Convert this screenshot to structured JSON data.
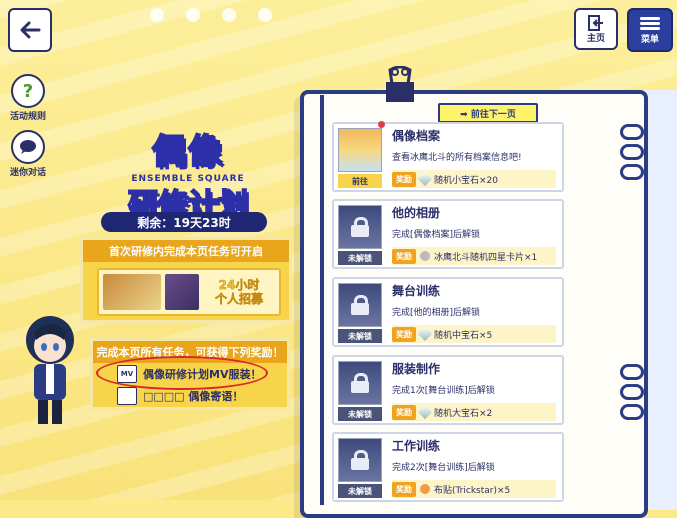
{
  "topbar": {
    "home_label": "主页",
    "menu_label": "菜单"
  },
  "side": {
    "rules_label": "活动规则",
    "chat_label": "迷你对话"
  },
  "event": {
    "title_line1": "偶像",
    "subtitle": "ENSEMBLE SQUARE",
    "title_line2": "研修计划",
    "remaining": "剩余：19天23时"
  },
  "first_box": {
    "title": "首次研修内完成本页任务可开启",
    "banner_text_line1": "24小时",
    "banner_text_line2": "个人招募"
  },
  "reward_box": {
    "title": "完成本页所有任务，可获得下列奖励！",
    "line1": "偶像研修计划MV服装！",
    "line1_icon": "MV",
    "line2": "□□□□ 偶像寄语！"
  },
  "notebook": {
    "next_page": "➡ 前往下一页",
    "reward_badge": "奖励",
    "cards": [
      {
        "title": "偶像档案",
        "desc": "查看冰鹰北斗的所有档案信息吧!",
        "status": "前往",
        "reward": "随机小宝石×20",
        "locked": false
      },
      {
        "title": "他的相册",
        "desc": "完成[偶像档案]后解锁",
        "status": "未解锁",
        "reward": "冰鹰北斗随机四星卡片×1",
        "locked": true
      },
      {
        "title": "舞台训练",
        "desc": "完成[他的相册]后解锁",
        "status": "未解锁",
        "reward": "随机中宝石×5",
        "locked": true
      },
      {
        "title": "服装制作",
        "desc": "完成1次[舞台训练]后解锁",
        "status": "未解锁",
        "reward": "随机大宝石×2",
        "locked": true
      },
      {
        "title": "工作训练",
        "desc": "完成2次[舞台训练]后解锁",
        "status": "未解锁",
        "reward": "布贴(Trickstar)×5",
        "locked": true
      }
    ]
  }
}
